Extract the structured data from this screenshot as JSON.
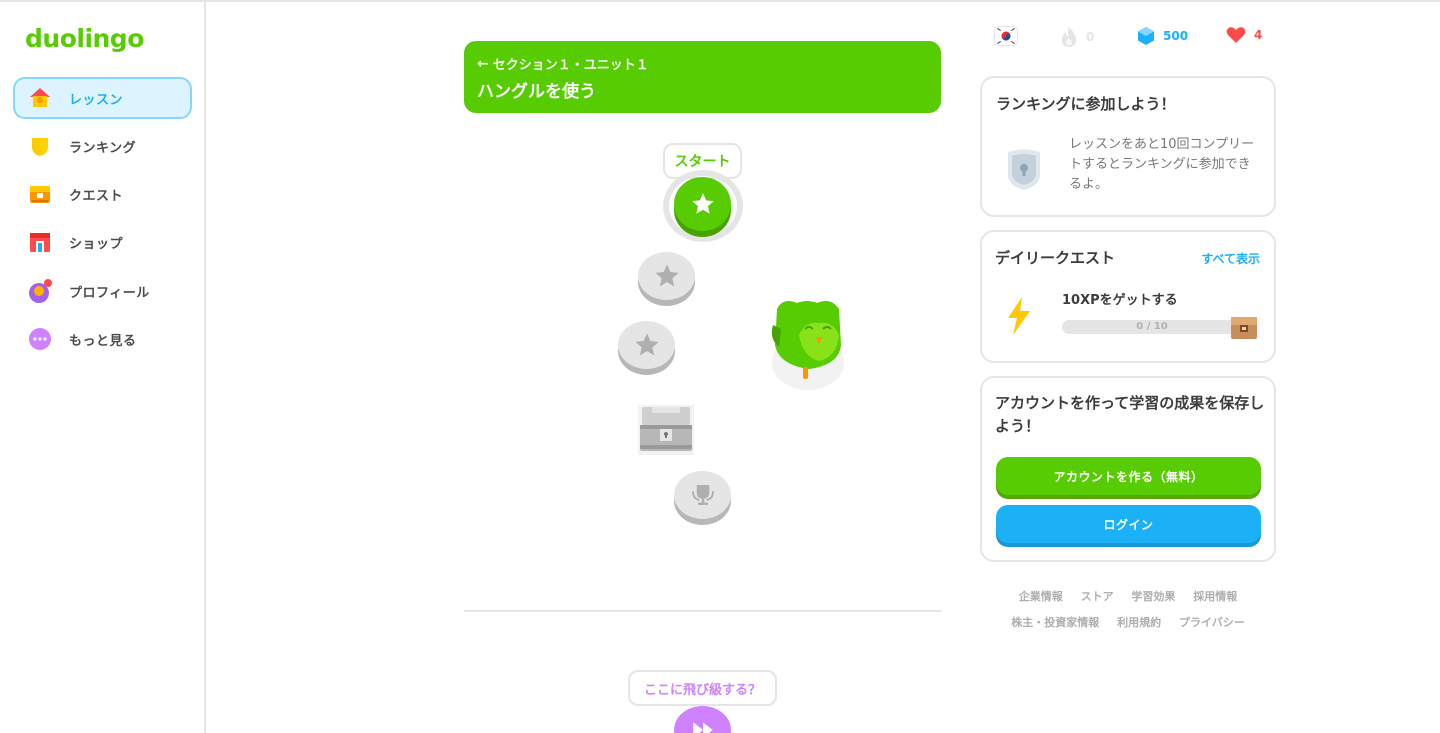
{
  "app": {
    "logo": "duolingo"
  },
  "sidebar": {
    "items": [
      {
        "label": "レッスン",
        "icon": "home-icon",
        "active": true
      },
      {
        "label": "ランキング",
        "icon": "shield-icon"
      },
      {
        "label": "クエスト",
        "icon": "treasure-chest-icon"
      },
      {
        "label": "ショップ",
        "icon": "shop-icon"
      },
      {
        "label": "プロフィール",
        "icon": "avatar-icon"
      },
      {
        "label": "もっと見る",
        "icon": "more-icon"
      }
    ]
  },
  "unit": {
    "subtitle": "セクション１・ユニット１",
    "title": "ハングルを使う"
  },
  "path": {
    "start_label": "スタート",
    "jump_label": "ここに飛び級する？"
  },
  "stats": {
    "language_flag": "korea-flag-icon",
    "streak": "0",
    "gems": "500",
    "hearts": "4"
  },
  "ranking_card": {
    "title": "ランキングに参加しよう！",
    "text": "レッスンをあと10回コンプリートするとランキングに参加できるよ。"
  },
  "quest_card": {
    "title": "デイリークエスト",
    "link": "すべて表示",
    "quest_label": "10XPをゲットする",
    "progress_text": "0 / 10",
    "progress_fraction": 0
  },
  "account_card": {
    "title": "アカウントを作って学習の成果を保存しよう！",
    "create_button": "アカウントを作る（無料）",
    "login_button": "ログイン"
  },
  "footer": {
    "row1": [
      "企業情報",
      "ストア",
      "学習効果",
      "採用情報"
    ],
    "row2": [
      "株主・投資家情報",
      "利用規約",
      "プライバシー"
    ]
  },
  "colors": {
    "brand_green": "#58cc02",
    "accent_blue": "#1cb0f6",
    "heart_red": "#ff4b4b",
    "purple": "#ce82ff"
  }
}
